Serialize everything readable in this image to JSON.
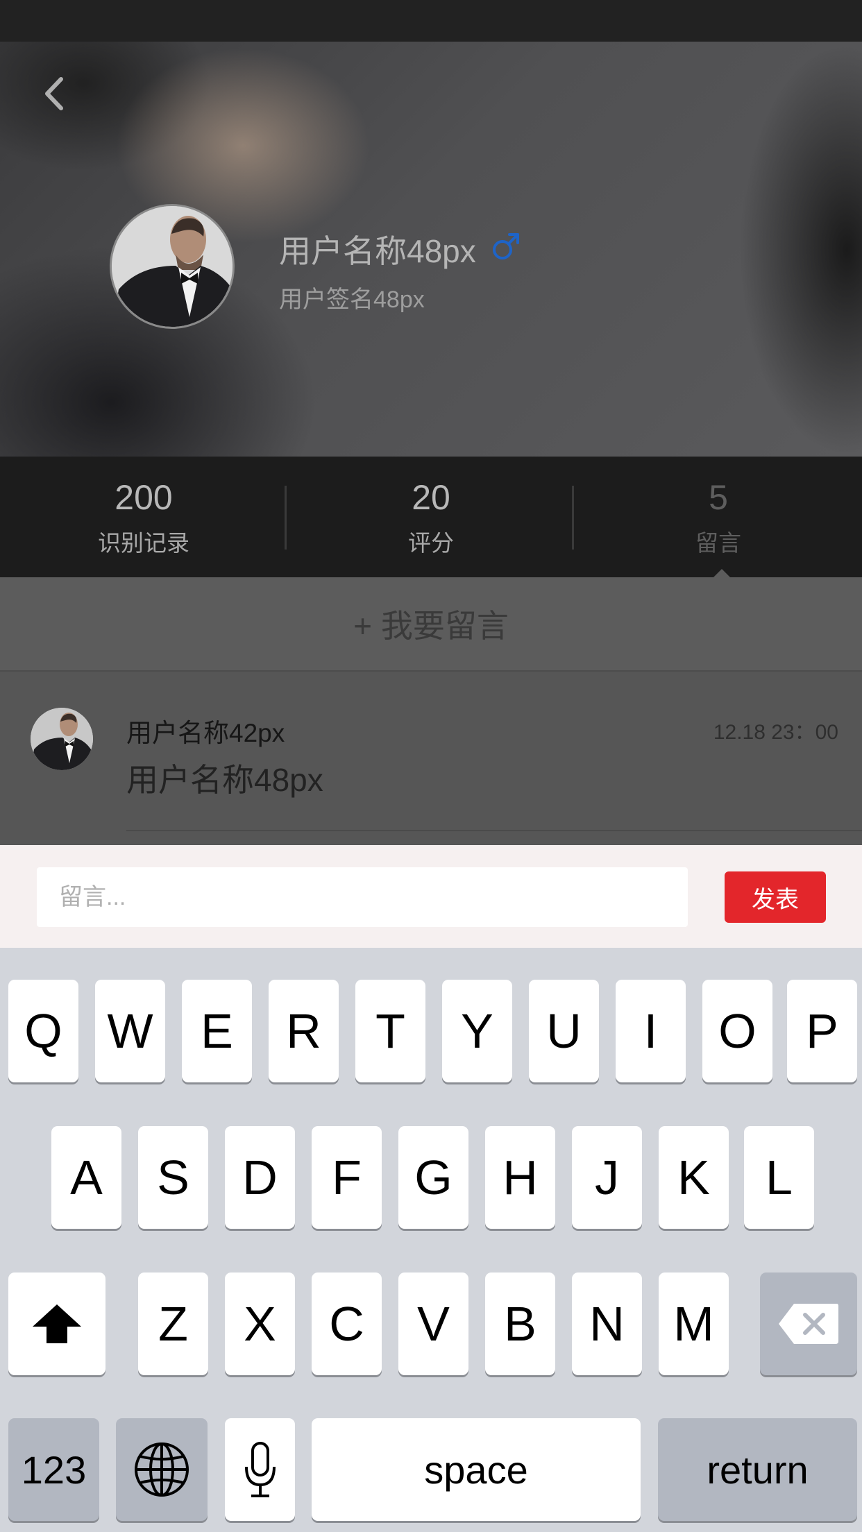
{
  "header": {
    "user_name": "用户名称48px",
    "user_signature": "用户签名48px",
    "gender_icon": "male-symbol-icon",
    "gender_color": "#1e64c8"
  },
  "stats": [
    {
      "value": "200",
      "label": "识别记录"
    },
    {
      "value": "20",
      "label": "评分"
    },
    {
      "value": "5",
      "label": "留言"
    }
  ],
  "actions": {
    "leave_message_label": "+ 我要留言"
  },
  "comments": [
    {
      "user_name": "用户名称42px",
      "text": "用户名称48px",
      "time": "12.18 23：00"
    }
  ],
  "input_bar": {
    "placeholder": "留言...",
    "value": "",
    "publish_label": "发表",
    "publish_color": "#e3262b"
  },
  "keyboard": {
    "row1": [
      "Q",
      "W",
      "E",
      "R",
      "T",
      "Y",
      "U",
      "I",
      "O",
      "P"
    ],
    "row2": [
      "A",
      "S",
      "D",
      "F",
      "G",
      "H",
      "J",
      "K",
      "L"
    ],
    "row3": [
      "Z",
      "X",
      "C",
      "V",
      "B",
      "N",
      "M"
    ],
    "numbers_label": "123",
    "space_label": "space",
    "return_label": "return"
  }
}
